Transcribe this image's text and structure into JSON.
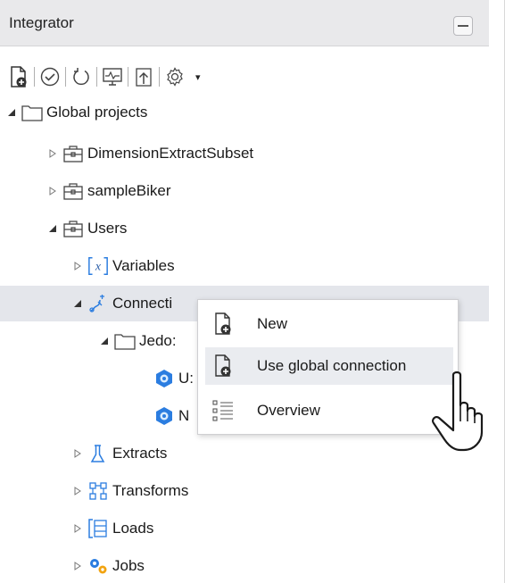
{
  "panel": {
    "title": "Integrator"
  },
  "toolbar": {
    "buttons": [
      "new-document-icon",
      "check-icon",
      "refresh-icon",
      "monitor-icon",
      "upload-icon",
      "gear-icon"
    ],
    "dropdown": "▾"
  },
  "tree": {
    "global_projects": "Global projects",
    "dimension_extract_subset": "DimensionExtractSubset",
    "sample_biker": "sampleBiker",
    "users": "Users",
    "variables": "Variables",
    "connections": "Connecti",
    "jedox_folder": "Jedo:",
    "conn_item_1": "U:",
    "conn_item_2": "N",
    "extracts": "Extracts",
    "transforms": "Transforms",
    "loads": "Loads",
    "jobs": "Jobs"
  },
  "context_menu": {
    "items": [
      {
        "label": "New",
        "icon": "new-document-icon"
      },
      {
        "label": "Use global connection",
        "icon": "new-document-icon",
        "highlighted": true
      },
      {
        "label": "Overview",
        "icon": "list-icon"
      }
    ]
  },
  "colors": {
    "accent_blue": "#2b7de0",
    "selection_bg": "#e4e6eb",
    "titlebar_bg": "#e9e9eb"
  }
}
